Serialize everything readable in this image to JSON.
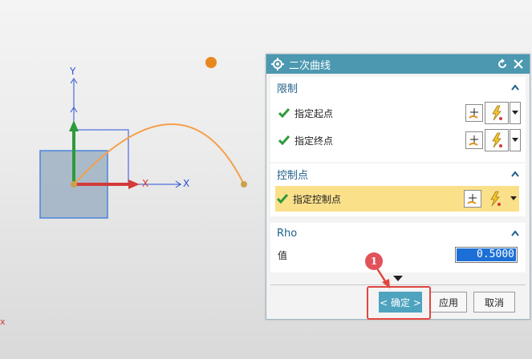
{
  "viewport": {
    "axis_labels": {
      "x": "X",
      "y": "Y"
    },
    "corner_mark": "x"
  },
  "dialog": {
    "title": "二次曲线",
    "sections": {
      "limits": {
        "header": "限制",
        "rows": [
          {
            "label": "指定起点"
          },
          {
            "label": "指定终点"
          }
        ]
      },
      "control_point": {
        "header": "控制点",
        "rows": [
          {
            "label": "指定控制点"
          }
        ]
      },
      "rho": {
        "header": "Rho",
        "value_label": "值",
        "value": "0.5000"
      }
    },
    "buttons": {
      "ok": "< 确定 >",
      "apply": "应用",
      "cancel": "取消"
    }
  },
  "annotation": {
    "badge": "1"
  },
  "colors": {
    "title_bar": "#4b98b0",
    "section_header": "#1f5f8a",
    "highlight_row": "#fbe08a",
    "ok_button": "#4ea3bf",
    "callout": "#e0463e",
    "curve": "#f4a04a"
  }
}
